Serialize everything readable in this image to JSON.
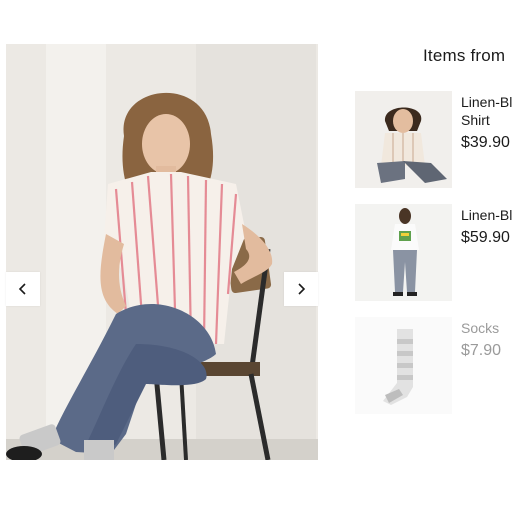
{
  "panel": {
    "title": "Items from"
  },
  "gallery": {
    "prev_icon": "chevron-left-icon",
    "next_icon": "chevron-right-icon"
  },
  "items": [
    {
      "name": "Linen-Bl",
      "name_line2": "Shirt",
      "price": "$39.90",
      "available": true
    },
    {
      "name": "Linen-Bl",
      "price": "$59.90",
      "available": true
    },
    {
      "name": "Socks",
      "price": "$7.90",
      "available": false
    }
  ],
  "colors": {
    "text": "#1b1b1b",
    "muted": "#9a9a9a",
    "stripe": "#e58b95"
  }
}
